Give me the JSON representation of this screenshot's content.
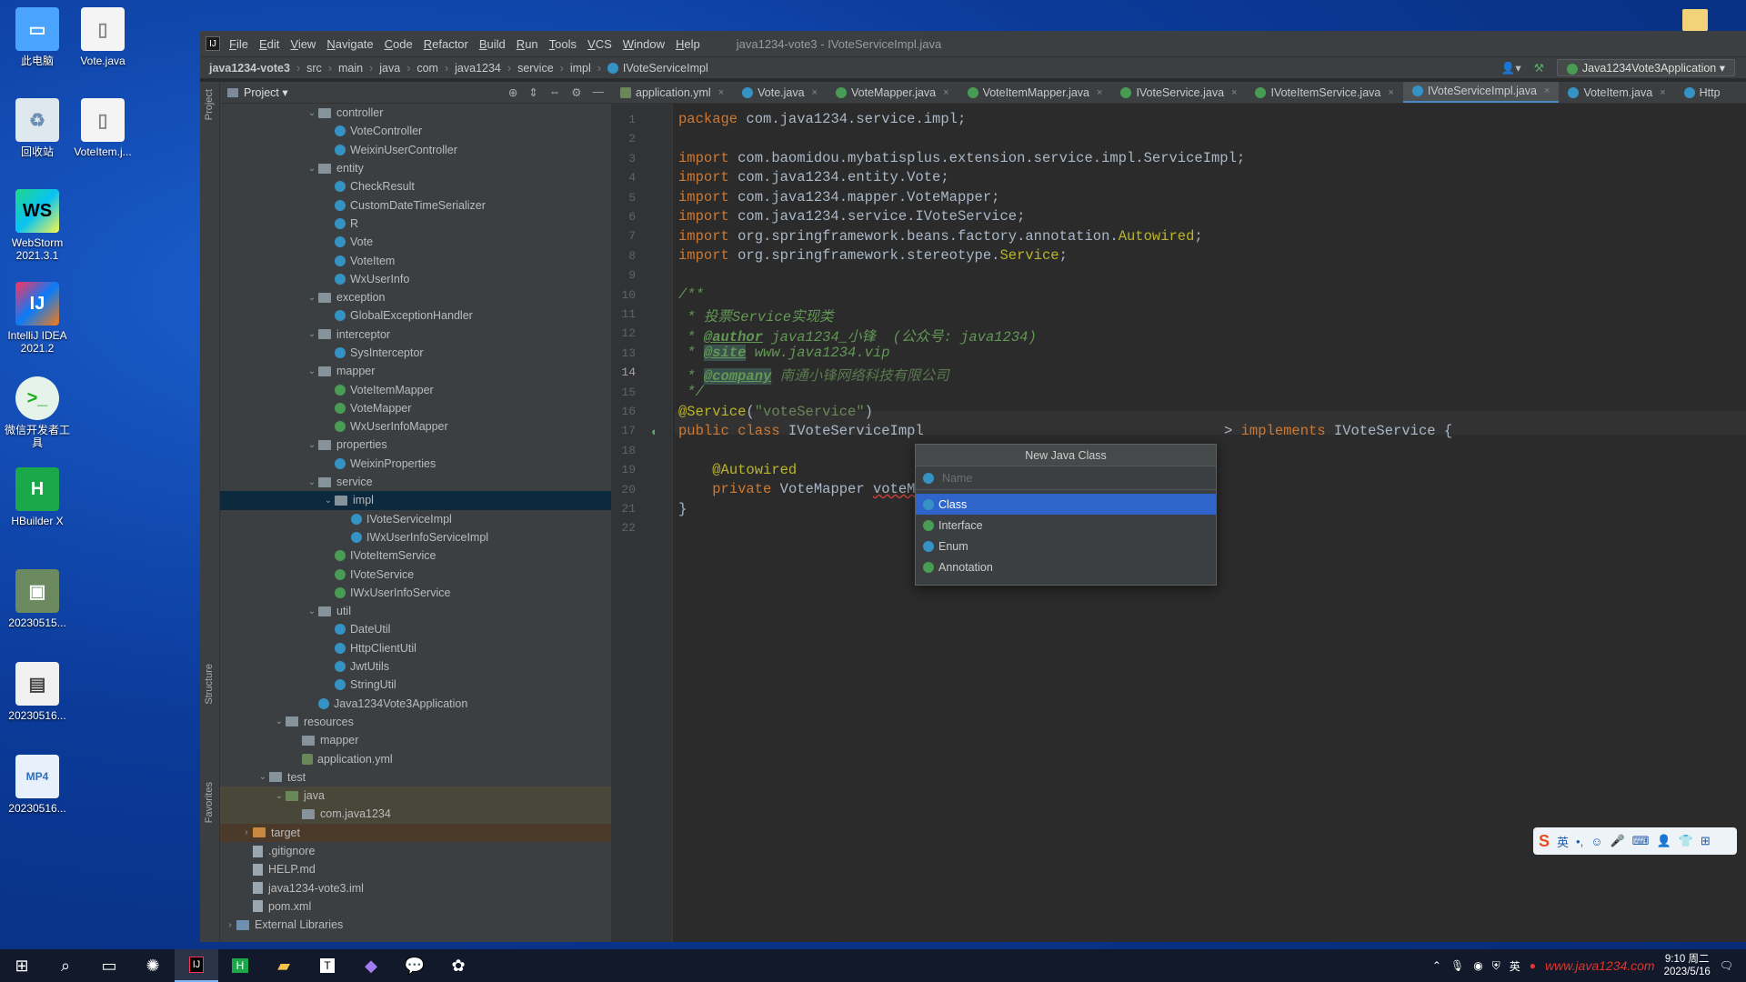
{
  "desktop": {
    "icons": [
      {
        "label": "此电脑",
        "icon": "computer-icon"
      },
      {
        "label": "Vote.java",
        "icon": "file-icon"
      },
      {
        "label": "回收站",
        "icon": "recycle-bin-icon"
      },
      {
        "label": "VoteItem.j...",
        "icon": "file-icon"
      },
      {
        "label": "WebStorm 2021.3.1",
        "icon": "webstorm-icon"
      },
      {
        "label": "IntelliJ IDEA 2021.2",
        "icon": "intellij-icon"
      },
      {
        "label": "微信开发者工具",
        "icon": "wechat-devtools-icon"
      },
      {
        "label": "HBuilder X",
        "icon": "hbuilder-icon"
      },
      {
        "label": "20230515...",
        "icon": "image-icon"
      },
      {
        "label": "20230516...",
        "icon": "video-icon"
      },
      {
        "label": "20230516...",
        "icon": "mp4-icon"
      }
    ]
  },
  "ide": {
    "menu": [
      "File",
      "Edit",
      "View",
      "Navigate",
      "Code",
      "Refactor",
      "Build",
      "Run",
      "Tools",
      "VCS",
      "Window",
      "Help"
    ],
    "window_title": "java1234-vote3 - IVoteServiceImpl.java",
    "breadcrumbs": [
      "java1234-vote3",
      "src",
      "main",
      "java",
      "com",
      "java1234",
      "service",
      "impl",
      "IVoteServiceImpl"
    ],
    "run_config": "Java1234Vote3Application",
    "project_panel_title": "Project",
    "strip_labels": {
      "project": "Project",
      "structure": "Structure",
      "favorites": "Favorites"
    },
    "tree": [
      {
        "label": "controller",
        "kind": "folder",
        "depth": 5,
        "open": true
      },
      {
        "label": "VoteController",
        "kind": "class",
        "depth": 6
      },
      {
        "label": "WeixinUserController",
        "kind": "class",
        "depth": 6
      },
      {
        "label": "entity",
        "kind": "folder",
        "depth": 5,
        "open": true
      },
      {
        "label": "CheckResult",
        "kind": "class",
        "depth": 6
      },
      {
        "label": "CustomDateTimeSerializer",
        "kind": "class",
        "depth": 6
      },
      {
        "label": "R",
        "kind": "class",
        "depth": 6
      },
      {
        "label": "Vote",
        "kind": "class",
        "depth": 6
      },
      {
        "label": "VoteItem",
        "kind": "class",
        "depth": 6
      },
      {
        "label": "WxUserInfo",
        "kind": "class",
        "depth": 6
      },
      {
        "label": "exception",
        "kind": "folder",
        "depth": 5,
        "open": true
      },
      {
        "label": "GlobalExceptionHandler",
        "kind": "class",
        "depth": 6
      },
      {
        "label": "interceptor",
        "kind": "folder",
        "depth": 5,
        "open": true
      },
      {
        "label": "SysInterceptor",
        "kind": "class",
        "depth": 6
      },
      {
        "label": "mapper",
        "kind": "folder",
        "depth": 5,
        "open": true
      },
      {
        "label": "VoteItemMapper",
        "kind": "interface",
        "depth": 6
      },
      {
        "label": "VoteMapper",
        "kind": "interface",
        "depth": 6
      },
      {
        "label": "WxUserInfoMapper",
        "kind": "interface",
        "depth": 6
      },
      {
        "label": "properties",
        "kind": "folder",
        "depth": 5,
        "open": true
      },
      {
        "label": "WeixinProperties",
        "kind": "class",
        "depth": 6
      },
      {
        "label": "service",
        "kind": "folder",
        "depth": 5,
        "open": true
      },
      {
        "label": "impl",
        "kind": "folder",
        "depth": 6,
        "open": true,
        "selected": true
      },
      {
        "label": "IVoteServiceImpl",
        "kind": "class",
        "depth": 7
      },
      {
        "label": "IWxUserInfoServiceImpl",
        "kind": "class",
        "depth": 7
      },
      {
        "label": "IVoteItemService",
        "kind": "interface",
        "depth": 6
      },
      {
        "label": "IVoteService",
        "kind": "interface",
        "depth": 6
      },
      {
        "label": "IWxUserInfoService",
        "kind": "interface",
        "depth": 6
      },
      {
        "label": "util",
        "kind": "folder",
        "depth": 5,
        "open": true
      },
      {
        "label": "DateUtil",
        "kind": "class",
        "depth": 6
      },
      {
        "label": "HttpClientUtil",
        "kind": "class",
        "depth": 6
      },
      {
        "label": "JwtUtils",
        "kind": "class",
        "depth": 6
      },
      {
        "label": "StringUtil",
        "kind": "class",
        "depth": 6
      },
      {
        "label": "Java1234Vote3Application",
        "kind": "app",
        "depth": 5
      },
      {
        "label": "resources",
        "kind": "resfolder",
        "depth": 3,
        "open": true
      },
      {
        "label": "mapper",
        "kind": "folder",
        "depth": 4
      },
      {
        "label": "application.yml",
        "kind": "yml",
        "depth": 4
      },
      {
        "label": "test",
        "kind": "folder",
        "depth": 2,
        "open": true
      },
      {
        "label": "java",
        "kind": "greenfolder",
        "depth": 3,
        "open": true,
        "highlight": "test"
      },
      {
        "label": "com.java1234",
        "kind": "folder",
        "depth": 4,
        "highlight": "test"
      },
      {
        "label": "target",
        "kind": "orangefolder",
        "depth": 1,
        "closed": true,
        "highlight": "target"
      },
      {
        "label": ".gitignore",
        "kind": "file",
        "depth": 1
      },
      {
        "label": "HELP.md",
        "kind": "file",
        "depth": 1
      },
      {
        "label": "java1234-vote3.iml",
        "kind": "file",
        "depth": 1
      },
      {
        "label": "pom.xml",
        "kind": "file",
        "depth": 1
      },
      {
        "label": "External Libraries",
        "kind": "libfolder",
        "depth": 0,
        "closed": true
      }
    ],
    "tabs": [
      {
        "label": "application.yml",
        "icon": "yml"
      },
      {
        "label": "Vote.java",
        "icon": "class"
      },
      {
        "label": "VoteMapper.java",
        "icon": "interface"
      },
      {
        "label": "VoteItemMapper.java",
        "icon": "interface"
      },
      {
        "label": "IVoteService.java",
        "icon": "interface"
      },
      {
        "label": "IVoteItemService.java",
        "icon": "interface"
      },
      {
        "label": "IVoteServiceImpl.java",
        "icon": "class",
        "active": true
      },
      {
        "label": "VoteItem.java",
        "icon": "class"
      },
      {
        "label": "Http",
        "icon": "class"
      }
    ],
    "line_numbers": [
      "1",
      "2",
      "3",
      "4",
      "5",
      "6",
      "7",
      "8",
      "9",
      "10",
      "11",
      "12",
      "13",
      "14",
      "15",
      "16",
      "17",
      "18",
      "19",
      "20",
      "21",
      "22"
    ],
    "current_line": 14,
    "code": {
      "l1_kw": "package",
      "l1_rest": " com.java1234.service.impl;",
      "l3_kw": "import",
      "l3_rest": " com.baomidou.mybatisplus.extension.service.impl.ServiceImpl;",
      "l4_kw": "import",
      "l4_rest": " com.java1234.entity.Vote;",
      "l5_kw": "import",
      "l5_rest": " com.java1234.mapper.VoteMapper;",
      "l6_kw": "import",
      "l6_rest": " com.java1234.service.IVoteService;",
      "l7_kw": "import",
      "l7_rest": " org.springframework.beans.factory.annotation.",
      "l7_ann": "Autowired",
      "l7_end": ";",
      "l8_kw": "import",
      "l8_rest": " org.springframework.stereotype.",
      "l8_ann": "Service",
      "l8_end": ";",
      "l10": "/**",
      "l11": " * 投票Service实现类",
      "l12_pre": " * ",
      "l12_tag": "@author",
      "l12_rest": " java1234_小锋  (公众号: java1234)",
      "l13_pre": " * ",
      "l13_tag": "@site",
      "l13_rest": " www.java1234.vip",
      "l14_pre": " * ",
      "l14_tag": "@company",
      "l14_rest": " 南通小锋网络科技有限公司",
      "l15": " */",
      "l16_ann": "@Service",
      "l16_open": "(",
      "l16_str": "\"voteService\"",
      "l16_close": ")",
      "l17_kw": "public class",
      "l17_name": " IVoteServiceImpl",
      "l17_tail_kw": "implements",
      "l17_tail": " IVoteService {",
      "l19_ann": "@Autowired",
      "l20_kw": "private",
      "l20_type": " VoteMapper ",
      "l20_fld": "voteMa",
      "l21": "}"
    },
    "popup": {
      "title": "New Java Class",
      "placeholder": "Name",
      "options": [
        {
          "label": "Class",
          "icon": "class",
          "selected": true
        },
        {
          "label": "Interface",
          "icon": "interface"
        },
        {
          "label": "Enum",
          "icon": "enum"
        },
        {
          "label": "Annotation",
          "icon": "annotation"
        }
      ]
    }
  },
  "ime": {
    "mode": "英"
  },
  "taskbar": {
    "time": "9:10 周二",
    "date": "2023/5/16",
    "tray_lang": "英",
    "watermark": "www.java1234.com"
  },
  "colors": {
    "accent": "#2f65ca",
    "tab_active_underline": "#4a88c7",
    "keyword": "#cc7832",
    "annotation": "#bbb529",
    "doc": "#629755"
  }
}
